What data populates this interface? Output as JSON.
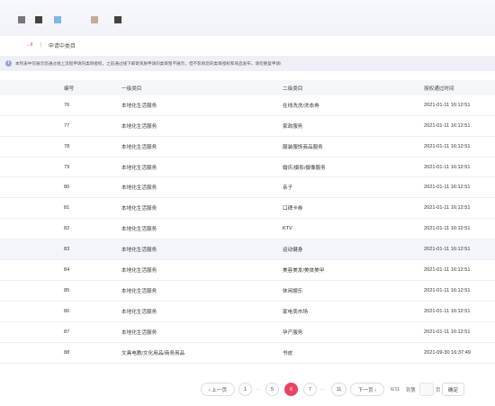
{
  "breadcrumb": {
    "home": "..ıl",
    "separator": "|",
    "current": "申请中类目"
  },
  "notice": {
    "icon": "info-icon",
    "text": "本列表中仅展示您通过线上流程申请的类目授权，之前通过线下邮寄资质申请的类目暂不展示，但不影响您的类目授权和商品发布，请勿重复申请!"
  },
  "table": {
    "headers": [
      "编号",
      "一级类目",
      "二级类目",
      "授权通过时间"
    ],
    "rows": [
      {
        "id": "76",
        "cat1": "本地化生活服务",
        "cat2": "在线洗洗/洗衣券",
        "time": "2021-01-11 16:12:51"
      },
      {
        "id": "77",
        "cat1": "本地化生活服务",
        "cat2": "家政服务",
        "time": "2021-01-11 16:12:51"
      },
      {
        "id": "78",
        "cat1": "本地化生活服务",
        "cat2": "服装服饰商品服务",
        "time": "2021-01-11 16:12:51"
      },
      {
        "id": "79",
        "cat1": "本地化生活服务",
        "cat2": "婚庆/摄影/摄像服务",
        "time": "2021-01-11 16:12:51"
      },
      {
        "id": "80",
        "cat1": "本地化生活服务",
        "cat2": "亲子",
        "time": "2021-01-11 16:12:51"
      },
      {
        "id": "81",
        "cat1": "本地化生活服务",
        "cat2": "口碑卡券",
        "time": "2021-01-11 16:12:51"
      },
      {
        "id": "82",
        "cat1": "本地化生活服务",
        "cat2": "KTV",
        "time": "2021-01-11 16:12:51"
      },
      {
        "id": "83",
        "cat1": "本地化生活服务",
        "cat2": "运动健身",
        "time": "2021-01-11 16:12:51"
      },
      {
        "id": "84",
        "cat1": "本地化生活服务",
        "cat2": "美容美发/美体美甲",
        "time": "2021-01-11 16:12:51"
      },
      {
        "id": "85",
        "cat1": "本地化生活服务",
        "cat2": "休闲娱乐",
        "time": "2021-01-11 16:12:51"
      },
      {
        "id": "86",
        "cat1": "本地化生活服务",
        "cat2": "家电卖市场",
        "time": "2021-01-11 16:12:51"
      },
      {
        "id": "87",
        "cat1": "本地化生活服务",
        "cat2": "孕产服务",
        "time": "2021-01-11 16:12:51"
      },
      {
        "id": "88",
        "cat1": "文具电教/文化用品/商务用品",
        "cat2": "书皮",
        "time": "2021-09-30 16:37:49"
      }
    ]
  },
  "pagination": {
    "prev": "‹ 上一页",
    "pages": [
      "1",
      "5",
      "6",
      "7",
      "11"
    ],
    "ellipsis": "···",
    "current": "6",
    "next": "下一页 ›",
    "page_info": "6/11",
    "goto_label": "到第",
    "page_unit": "页",
    "confirm": "确定"
  },
  "colors": {
    "accent": "#e94464",
    "notice_bg": "#eef0f7",
    "header_bg": "#f5f6f9"
  }
}
